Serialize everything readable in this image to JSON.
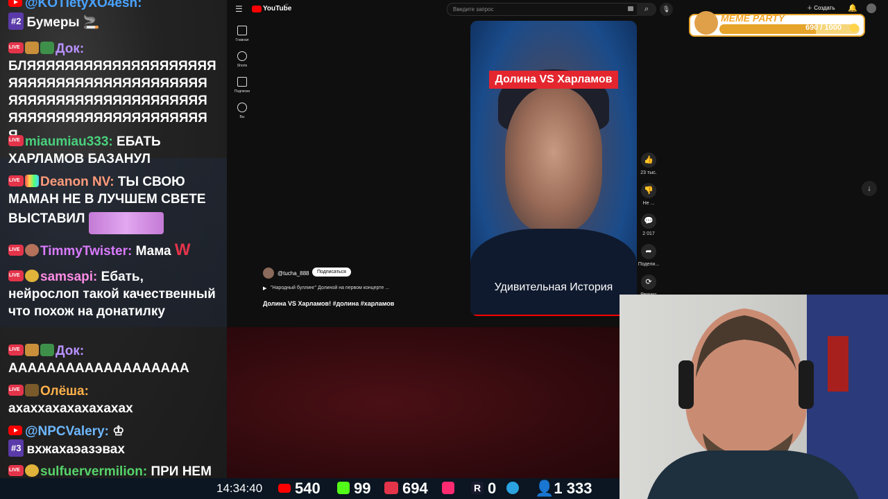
{
  "chat": {
    "messages": [
      {
        "prefix": "",
        "user": "@KOTIetyXO4esh:",
        "user_color": "#4aa3ff",
        "text": ""
      },
      {
        "prefix": "#2",
        "user": "",
        "user_color": "#fff",
        "text": "Бумеры 🚬"
      },
      {
        "prefix": "",
        "user": "Док:",
        "user_color": "#b892ff",
        "text": "БЛЯЯЯЯЯЯЯЯЯЯЯЯЯЯЯЯЯЯЯЯЯЯЯЯЯЯЯЯЯЯЯЯЯЯЯЯЯЯЯЯЯЯЯЯЯЯЯЯЯЯЯЯЯЯЯЯЯЯЯЯЯЯЯЯЯЯЯЯЯЯЯЯЯЯЯЯЯЯЯЯЯЯЯЯ"
      },
      {
        "prefix": "",
        "user": "miaumiau333:",
        "user_color": "#49d17d",
        "text": "ЕБАТЬ ХАРЛАМОВ БАЗАНУЛ"
      },
      {
        "prefix": "",
        "user": "Deanon NV:",
        "user_color": "#ff9b7a",
        "text": "ТЫ СВОЮ МАМАН НЕ В ЛУЧШЕМ СВЕТЕ ВЫСТАВИЛ"
      },
      {
        "prefix": "",
        "user": "TimmyTwister:",
        "user_color": "#d97bff",
        "text": "Мама"
      },
      {
        "prefix": "",
        "user": "samsapi:",
        "user_color": "#ff8de5",
        "text": "Ебать, нейрослоп такой качественный что похож на донатилку"
      },
      {
        "prefix": "",
        "user": "Док:",
        "user_color": "#b892ff",
        "text": "ААААААААААААААААААА"
      },
      {
        "prefix": "",
        "user": "Олёша:",
        "user_color": "#ffb14a",
        "text": "ахаххахахахахахах"
      },
      {
        "prefix": "",
        "user": "@NPCValery:",
        "user_color": "#6eb8ff",
        "text": ""
      },
      {
        "prefix": "#3",
        "user": "",
        "user_color": "#fff",
        "text": "вхжахаэазэвах"
      },
      {
        "prefix": "",
        "user": "sulfuervermilion:",
        "user_color": "#56d36a",
        "text": "ПРИ НЕМ ОНЛИФАНСА НЕ БЫЛО"
      }
    ]
  },
  "youtube": {
    "logo": "YouTube",
    "region": "AT",
    "search_placeholder": "Введите запрос",
    "create_label": "Создать",
    "nav": [
      "Главная",
      "Shorts",
      "Подписки",
      "Вы"
    ],
    "short": {
      "title_badge": "Долина VS Харламов",
      "overlay_text": "Удивительная История",
      "channel": "@tucha_888",
      "subscribe_label": "Подписаться",
      "playlist_text": "\"Народный буллинг\" Долиной на первом концерте ...",
      "caption": "Долина VS Харламов! #долина #харламов"
    },
    "actions": [
      {
        "icon": "like-icon",
        "label": "23 тыс."
      },
      {
        "icon": "dislike-icon",
        "label": "Не ..."
      },
      {
        "icon": "comment-icon",
        "label": "2 017"
      },
      {
        "icon": "share-icon",
        "label": "Подели..."
      },
      {
        "icon": "remix-icon",
        "label": "Ремикс"
      }
    ]
  },
  "meme_party": {
    "title": "MEME PARTY",
    "progress_text": "690 / 1000",
    "progress": 0.69
  },
  "stats": {
    "time": "14:34:40",
    "youtube": "540",
    "kick": "99",
    "vk": "694",
    "unknown": "",
    "rutube": "0",
    "telegram": "",
    "viewers": "1 333"
  },
  "colors": {
    "live": "#e4344a",
    "youtube_red": "#ff0000",
    "kick_green": "#53fc18",
    "meme_gold": "#e7a42a"
  }
}
